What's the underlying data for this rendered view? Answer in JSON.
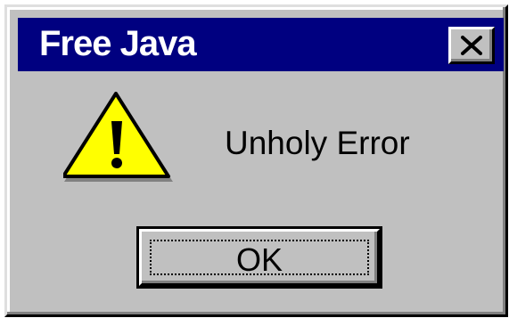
{
  "window": {
    "title": "Free Java"
  },
  "dialog": {
    "message": "Unholy Error",
    "icon": "warning-icon"
  },
  "buttons": {
    "ok_label": "OK",
    "close_icon": "close-icon"
  },
  "colors": {
    "titlebar": "#000080",
    "face": "#c0c0c0",
    "warning_fill": "#ffff00"
  }
}
